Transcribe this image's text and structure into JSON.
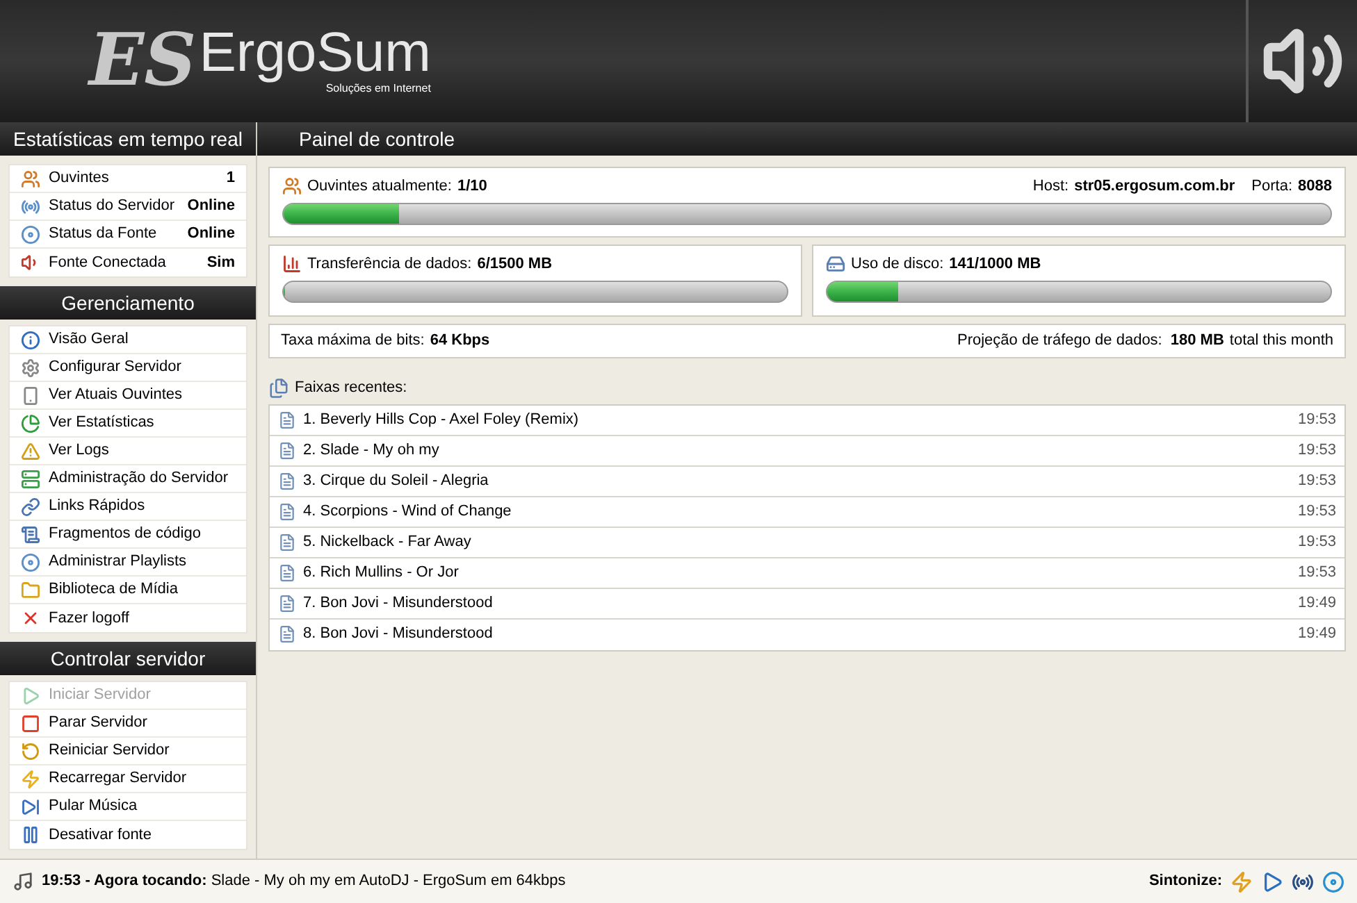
{
  "header": {
    "logo_mark": "ES",
    "logo_name": "ErgoSum",
    "tagline": "Soluções em Internet"
  },
  "sidebar": {
    "stats_title": "Estatísticas em tempo real",
    "stats": [
      {
        "kind": "users",
        "label": "Ouvintes",
        "value": "1"
      },
      {
        "kind": "antenna",
        "label": "Status do Servidor",
        "value": "Online"
      },
      {
        "kind": "disc",
        "label": "Status da Fonte",
        "value": "Online"
      },
      {
        "kind": "speaker",
        "label": "Fonte Conectada",
        "value": "Sim"
      }
    ],
    "manage_title": "Gerenciamento",
    "manage": [
      {
        "kind": "info",
        "label": "Visão Geral",
        "disabled": false
      },
      {
        "kind": "gear",
        "label": "Configurar Servidor",
        "disabled": false
      },
      {
        "kind": "device",
        "label": "Ver Atuais Ouvintes",
        "disabled": false
      },
      {
        "kind": "pie",
        "label": "Ver Estatísticas",
        "disabled": false
      },
      {
        "kind": "warning",
        "label": "Ver Logs",
        "disabled": false
      },
      {
        "kind": "server",
        "label": "Administração do Servidor",
        "disabled": false
      },
      {
        "kind": "link",
        "label": "Links Rápidos",
        "disabled": false
      },
      {
        "kind": "scroll",
        "label": "Fragmentos de código",
        "disabled": false
      },
      {
        "kind": "disc",
        "label": "Administrar Playlists",
        "disabled": false
      },
      {
        "kind": "folder",
        "label": "Biblioteca de Mídia",
        "disabled": false
      },
      {
        "kind": "x",
        "label": "Fazer logoff",
        "disabled": false
      }
    ],
    "control_title": "Controlar servidor",
    "control": [
      {
        "kind": "play",
        "label": "Iniciar Servidor",
        "disabled": true
      },
      {
        "kind": "stop",
        "label": "Parar Servidor",
        "disabled": false
      },
      {
        "kind": "restart",
        "label": "Reiniciar Servidor",
        "disabled": false
      },
      {
        "kind": "bolt",
        "label": "Recarregar Servidor",
        "disabled": false
      },
      {
        "kind": "skip",
        "label": "Pular Música",
        "disabled": false
      },
      {
        "kind": "pause",
        "label": "Desativar fonte",
        "disabled": false
      }
    ]
  },
  "panel": {
    "title": "Painel de controle",
    "listeners": {
      "label": "Ouvintes atualmente:",
      "value": "1/10",
      "host_label": "Host:",
      "host": "str05.ergosum.com.br",
      "port_label": "Porta:",
      "port": "8088",
      "level": 0.11
    },
    "transfer": {
      "label": "Transferência de dados:",
      "value": "6/1500 MB",
      "level": 0.004
    },
    "disk": {
      "label": "Uso de disco:",
      "value": "141/1000 MB",
      "level": 0.141
    },
    "bitrate": {
      "label": "Taxa máxima de bits:",
      "value": "64 Kbps",
      "projection_label": "Projeção de tráfego de dados:",
      "projection_value": "180 MB",
      "projection_suffix": "total this month"
    },
    "tracks_title": "Faixas recentes:",
    "tracks": [
      {
        "title": "1. Beverly Hills Cop - Axel Foley (Remix)",
        "time": "19:53"
      },
      {
        "title": "2. Slade - My oh my",
        "time": "19:53"
      },
      {
        "title": "3. Cirque du Soleil - Alegria",
        "time": "19:53"
      },
      {
        "title": "4. Scorpions - Wind of Change",
        "time": "19:53"
      },
      {
        "title": "5. Nickelback - Far Away",
        "time": "19:53"
      },
      {
        "title": "6. Rich Mullins - Or Jor",
        "time": "19:53"
      },
      {
        "title": "7. Bon Jovi - Misunderstood",
        "time": "19:49"
      },
      {
        "title": "8. Bon Jovi - Misunderstood",
        "time": "19:49"
      }
    ]
  },
  "footer": {
    "now_playing": "**19:53 - Agora tocando:** Slade - My oh my em AutoDJ - ErgoSum em 64kbps",
    "tune_label": "Sintonize:"
  }
}
